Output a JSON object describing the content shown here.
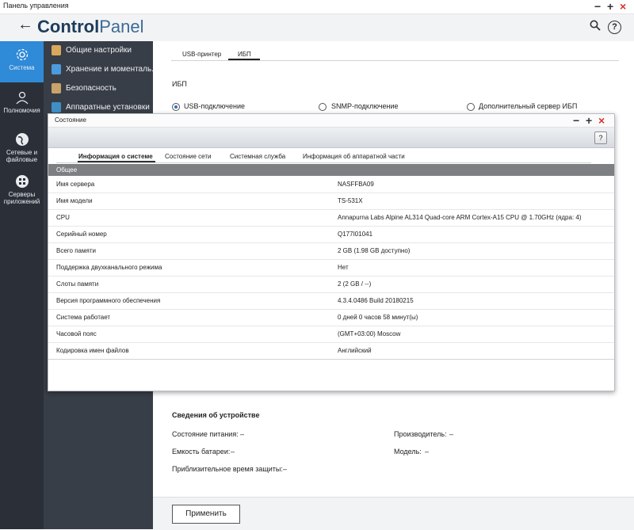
{
  "window": {
    "title": "Панель управления",
    "min": "−",
    "max": "+",
    "close": "×"
  },
  "header": {
    "back": "←",
    "title_bold": "Control",
    "title_light": "Panel",
    "search": "⚲",
    "help": "?"
  },
  "nav": [
    {
      "label": "Система"
    },
    {
      "label": "Полномочия"
    },
    {
      "label": "Сетевые и файловые"
    },
    {
      "label": "Серверы приложений"
    }
  ],
  "subnav": [
    {
      "label": "Общие настройки"
    },
    {
      "label": "Хранение и моменталь..."
    },
    {
      "label": "Безопасность"
    },
    {
      "label": "Аппаратные установки"
    }
  ],
  "main": {
    "tabs": [
      "USB-принтер",
      "ИБП"
    ],
    "section_title": "ИБП",
    "radios": [
      "USB-подключение",
      "SNMP-подключение",
      "Дополнительный сервер ИБП"
    ],
    "device_section": "Сведения об устройстве",
    "power_state": "Состояние питания:",
    "power_state_value": "–",
    "manufacturer": "Производитель:",
    "manufacturer_value": "–",
    "battery": "Емкость батареи:",
    "battery_value": "–",
    "model": "Модель:",
    "model_value": "–",
    "runtime": "Приблизительное время защиты:",
    "runtime_value": "–",
    "apply": "Применить"
  },
  "modal": {
    "title": "Состояние",
    "help": "?",
    "tabs": [
      "Информация о системе",
      "Состояние сети",
      "Системная служба",
      "Информация об аппаратной части"
    ],
    "section": "Общее",
    "rows": [
      {
        "key": "Имя сервера",
        "value": "NASFFBA09"
      },
      {
        "key": "Имя модели",
        "value": "TS-531X"
      },
      {
        "key": "CPU",
        "value": "Annapurna Labs Alpine AL314 Quad-core ARM Cortex-A15 CPU @ 1.70GHz (ядра: 4)"
      },
      {
        "key": "Серийный номер",
        "value": "Q177I01041"
      },
      {
        "key": "Всего памяти",
        "value": "2 GB (1.98 GB доступно)"
      },
      {
        "key": "Поддержка двухканального режима",
        "value": "Нет"
      },
      {
        "key": "Слоты памяти",
        "value": "2 (2 GB / --)"
      },
      {
        "key": "Версия программного обеспечения",
        "value": "4.3.4.0486 Build 20180215"
      },
      {
        "key": "Система работает",
        "value": "0 дней 0 часов 58 минут(ы)"
      },
      {
        "key": "Часовой пояс",
        "value": "(GMT+03:00) Moscow"
      },
      {
        "key": "Кодировка имен файлов",
        "value": "Английский"
      }
    ]
  },
  "colors": {
    "accent": "#2f8ad8",
    "sidebar": "#2b3038",
    "subnav": "#383e47",
    "close": "#d9302c"
  }
}
